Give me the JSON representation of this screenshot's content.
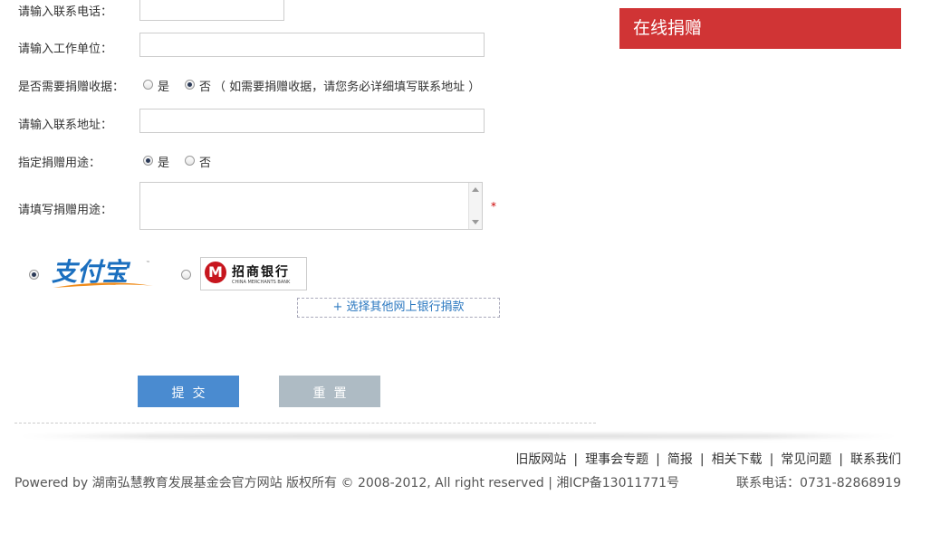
{
  "form": {
    "phone_label": "请输入联系电话：",
    "company_label": "请输入工作单位：",
    "receipt_label": "是否需要捐赠收据：",
    "receipt_yes": "是",
    "receipt_no": "否",
    "receipt_note": "（ 如需要捐赠收据，请您务必详细填写联系地址 ）",
    "address_label": "请输入联系地址：",
    "designate_label": "指定捐赠用途：",
    "designate_yes": "是",
    "designate_no": "否",
    "purpose_label": "请填写捐赠用途：",
    "required_mark": "*"
  },
  "sidebar": {
    "donate_title": "在线捐赠"
  },
  "payment": {
    "alipay_logo_text": "支付宝",
    "cmb_name_cn": "招商银行",
    "cmb_name_en": "CHINA MERCHANTS BANK",
    "other_bank_label": "+ 选择其他网上银行捐款"
  },
  "buttons": {
    "submit": "提交",
    "reset": "重置"
  },
  "footer": {
    "links": [
      "旧版网站",
      "理事会专题",
      "简报",
      "相关下载",
      "常见问题",
      "联系我们"
    ],
    "copyright": "Powered by 湖南弘慧教育发展基金会官方网站 版权所有 © 2008-2012, All right reserved | 湘ICP备13011771号",
    "phone": "联系电话：0731-82868919"
  },
  "colors": {
    "brand_red": "#d03435",
    "submit_blue": "#4a8bd0",
    "reset_gray": "#aebbc4",
    "link_blue": "#2b78c0"
  }
}
